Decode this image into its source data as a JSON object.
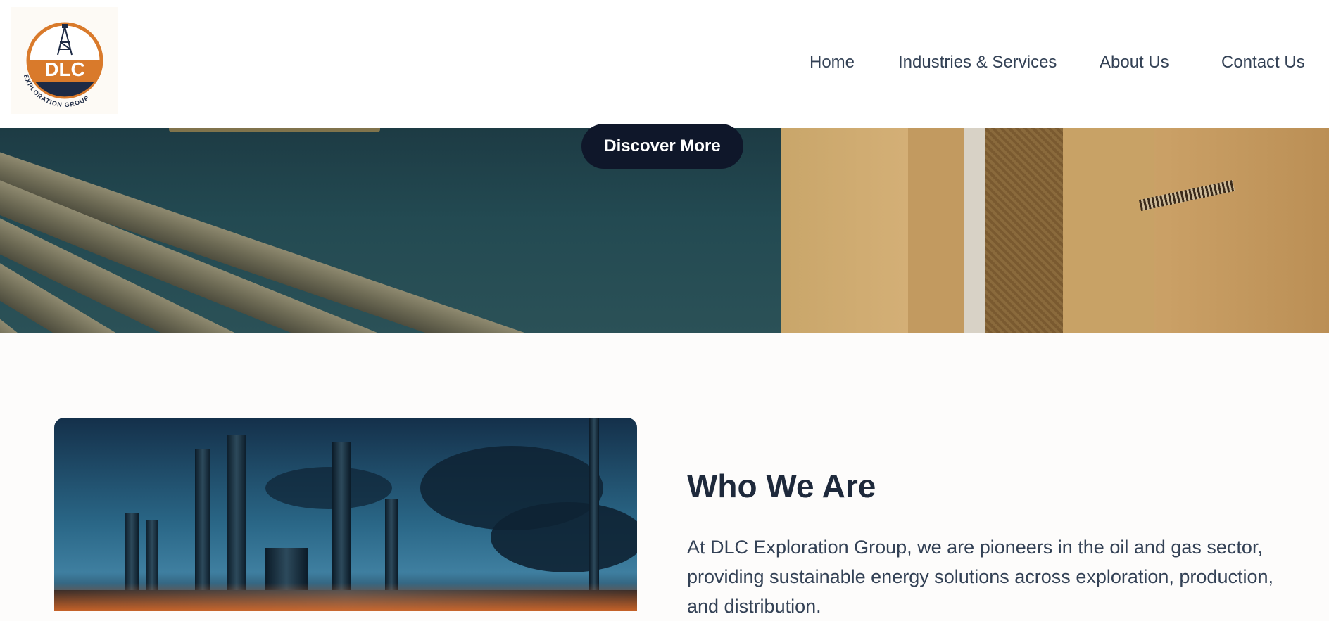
{
  "brand": {
    "logo_line1": "DLC",
    "logo_line2": "EXPLORATION GROUP",
    "colors": {
      "orange": "#d97a2b",
      "navy": "#1e2b45"
    }
  },
  "nav": {
    "items": [
      {
        "label": "Home"
      },
      {
        "label": "Industries & Services"
      },
      {
        "label": "About Us"
      },
      {
        "label": "Contact Us"
      }
    ]
  },
  "hero": {
    "button_label": "Discover More"
  },
  "who": {
    "title": "Who We Are",
    "body": "At DLC Exploration Group, we are pioneers in the oil and gas sector, providing sustainable energy solutions across exploration, production, and distribution."
  },
  "colors": {
    "dark_button": "#0f172a",
    "text_primary": "#1e293b",
    "page_bg": "#fdfcfb"
  }
}
